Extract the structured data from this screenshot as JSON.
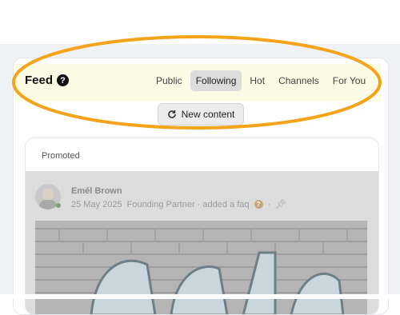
{
  "feed": {
    "title": "Feed",
    "tabs": [
      {
        "label": "Public",
        "active": false
      },
      {
        "label": "Following",
        "active": true
      },
      {
        "label": "Hot",
        "active": false
      },
      {
        "label": "Channels",
        "active": false
      },
      {
        "label": "For You",
        "active": false
      }
    ],
    "new_content_label": "New content"
  },
  "promoted": {
    "label": "Promoted",
    "post": {
      "author": "Emél Brown",
      "date": "25 May 2025",
      "action": "Founding Partner · added a faq",
      "separator": "·"
    }
  },
  "colors": {
    "highlight_ellipse": "#f5a31a",
    "header_bg": "#fbfbe6",
    "active_tab_bg": "#dcdcdc"
  }
}
